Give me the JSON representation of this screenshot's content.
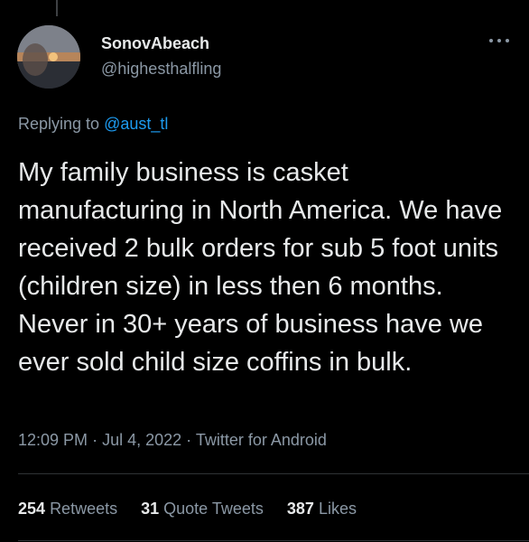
{
  "tweet": {
    "author": {
      "display_name": "SonovAbeach",
      "handle": "@highesthalfling",
      "avatar_icon": "sunset-profile-photo"
    },
    "more_icon": "more-horizontal-icon",
    "reply": {
      "prefix": "Replying to",
      "target": "@aust_tl"
    },
    "text": "My family business is casket manufacturing in North America. We have received 2 bulk orders for sub 5 foot units (children size) in less then 6 months. Never in 30+ years of business have we ever sold child size coffins in bulk.",
    "meta": {
      "time": "12:09 PM",
      "date": "Jul 4, 2022",
      "source": "Twitter for Android",
      "separator": "·"
    },
    "stats": {
      "retweets_count": "254",
      "retweets_label": "Retweets",
      "quote_tweets_count": "31",
      "quote_tweets_label": "Quote Tweets",
      "likes_count": "387",
      "likes_label": "Likes"
    }
  },
  "colors": {
    "background": "#000000",
    "text_primary": "#e7e9ea",
    "text_secondary": "#8b98a5",
    "link": "#1d9bf0",
    "divider": "#2f3336"
  }
}
